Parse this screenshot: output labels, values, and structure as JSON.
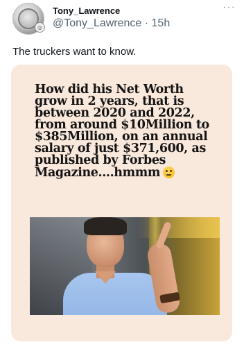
{
  "author": {
    "display_name": "Tony_Lawrence",
    "handle_line": "@Tony_Lawrence · 15h"
  },
  "menu": {
    "more_glyph": "···"
  },
  "tweet": {
    "text": "The truckers want to know."
  },
  "meme": {
    "headline_lines": [
      "How did his Net Worth",
      "grow in 2 years, that is",
      "between 2020 and 2022,",
      "from around $10Million to",
      "$385Million, on an annual",
      "salary of just $371,600, as",
      "published by Forbes",
      "Magazine....hmmm"
    ],
    "emoji": "thinking-face",
    "background_color": "#f9e8dc"
  },
  "colors": {
    "name": "#0f1419",
    "secondary": "#536471"
  }
}
